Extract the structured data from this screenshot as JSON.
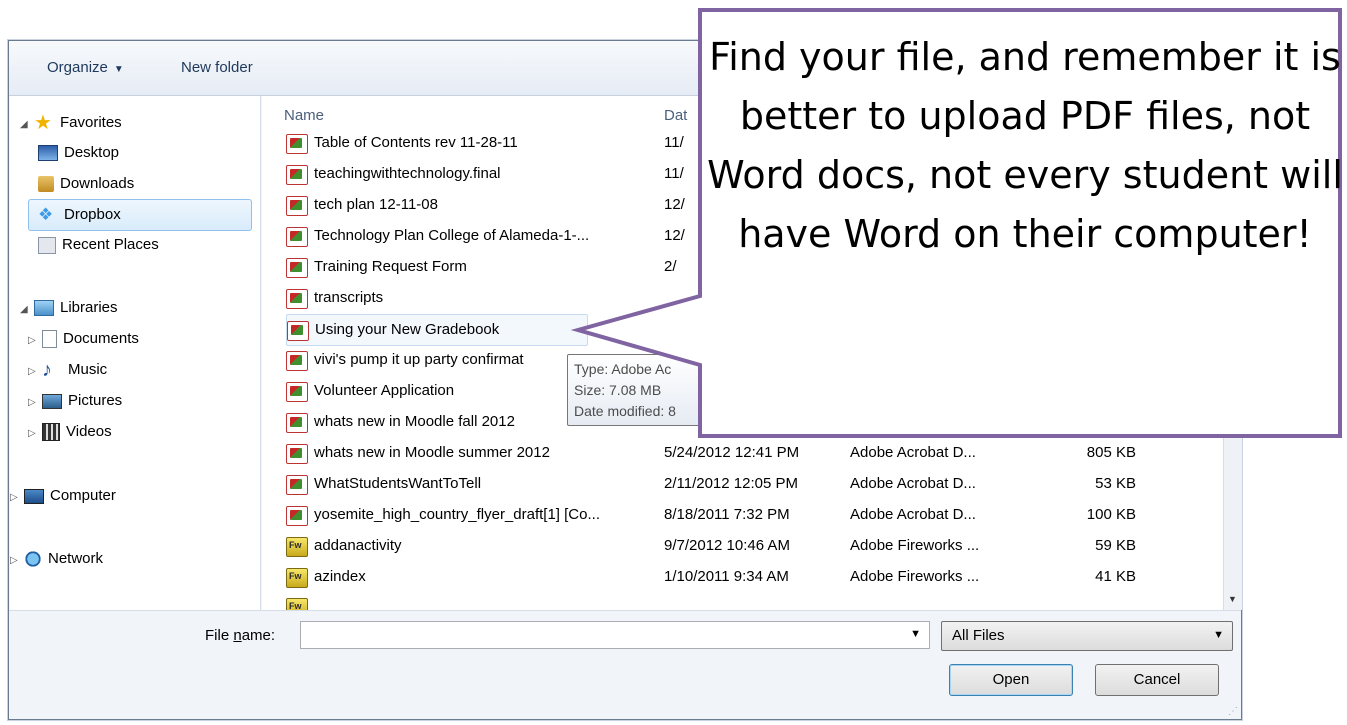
{
  "toolbar": {
    "organize_label": "Organize",
    "new_folder_label": "New folder"
  },
  "nav": {
    "items": [
      {
        "label": "Favorites",
        "icon": "star-icon"
      },
      {
        "label": "Desktop",
        "icon": "desktop-icon"
      },
      {
        "label": "Downloads",
        "icon": "downloads-icon"
      },
      {
        "label": "Dropbox",
        "icon": "dropbox-icon"
      },
      {
        "label": "Recent Places",
        "icon": "recent-places-icon"
      },
      {
        "label": "Libraries",
        "icon": "libraries-icon"
      },
      {
        "label": "Documents",
        "icon": "documents-icon"
      },
      {
        "label": "Music",
        "icon": "music-icon"
      },
      {
        "label": "Pictures",
        "icon": "pictures-icon"
      },
      {
        "label": "Videos",
        "icon": "videos-icon"
      },
      {
        "label": "Computer",
        "icon": "computer-icon"
      },
      {
        "label": "Network",
        "icon": "network-icon"
      }
    ]
  },
  "list": {
    "columns": {
      "name": "Name",
      "date": "Dat"
    },
    "rows": [
      {
        "name": "Table of Contents rev 11-28-11",
        "date": "11/",
        "type": "",
        "size": "",
        "icon": "pdf-icon"
      },
      {
        "name": "teachingwithtechnology.final",
        "date": "11/",
        "type": "",
        "size": "",
        "icon": "pdf-icon"
      },
      {
        "name": "tech plan 12-11-08",
        "date": "12/",
        "type": "",
        "size": "",
        "icon": "pdf-icon"
      },
      {
        "name": "Technology Plan College of Alameda-1-...",
        "date": "12/",
        "type": "",
        "size": "",
        "icon": "pdf-icon"
      },
      {
        "name": "Training Request Form",
        "date": "2/",
        "type": "",
        "size": "",
        "icon": "pdf-icon"
      },
      {
        "name": "transcripts",
        "date": "",
        "type": "",
        "size": "",
        "icon": "pdf-icon"
      },
      {
        "name": "Using your New Gradebook",
        "date": "",
        "type": "",
        "size": "",
        "icon": "pdf-icon"
      },
      {
        "name": "vivi's pump it up party confirmat",
        "date": "",
        "type": "",
        "size": "",
        "icon": "pdf-icon"
      },
      {
        "name": "Volunteer Application",
        "date": "",
        "type": "",
        "size": "",
        "icon": "pdf-icon"
      },
      {
        "name": "whats new in Moodle fall 2012",
        "date": "",
        "type": "",
        "size": "",
        "icon": "pdf-icon"
      },
      {
        "name": "whats new in Moodle summer 2012",
        "date": "5/24/2012 12:41 PM",
        "type": "Adobe Acrobat D...",
        "size": "805 KB",
        "icon": "pdf-icon"
      },
      {
        "name": "WhatStudentsWantToTell",
        "date": "2/11/2012 12:05 PM",
        "type": "Adobe Acrobat D...",
        "size": "53 KB",
        "icon": "pdf-icon"
      },
      {
        "name": "yosemite_high_country_flyer_draft[1] [Co...",
        "date": "8/18/2011 7:32 PM",
        "type": "Adobe Acrobat D...",
        "size": "100 KB",
        "icon": "pdf-icon"
      },
      {
        "name": "addanactivity",
        "date": "9/7/2012 10:46 AM",
        "type": "Adobe Fireworks ...",
        "size": "59 KB",
        "icon": "fireworks-icon"
      },
      {
        "name": "azindex",
        "date": "1/10/2011 9:34 AM",
        "type": "Adobe Fireworks ...",
        "size": "41 KB",
        "icon": "fireworks-icon"
      }
    ]
  },
  "tooltip": {
    "type": "Type: Adobe Ac",
    "size": "Size: 7.08 MB",
    "modified": "Date modified: 8"
  },
  "bottom": {
    "file_name_label": "File name:",
    "file_name_value": "",
    "filter_value": "All Files",
    "open_label": "Open",
    "cancel_label": "Cancel"
  },
  "callout": {
    "text": "Find your file, and remember it is better to upload PDF files, not Word docs, not every student will have Word on their computer!",
    "border_color": "#8064a2"
  }
}
